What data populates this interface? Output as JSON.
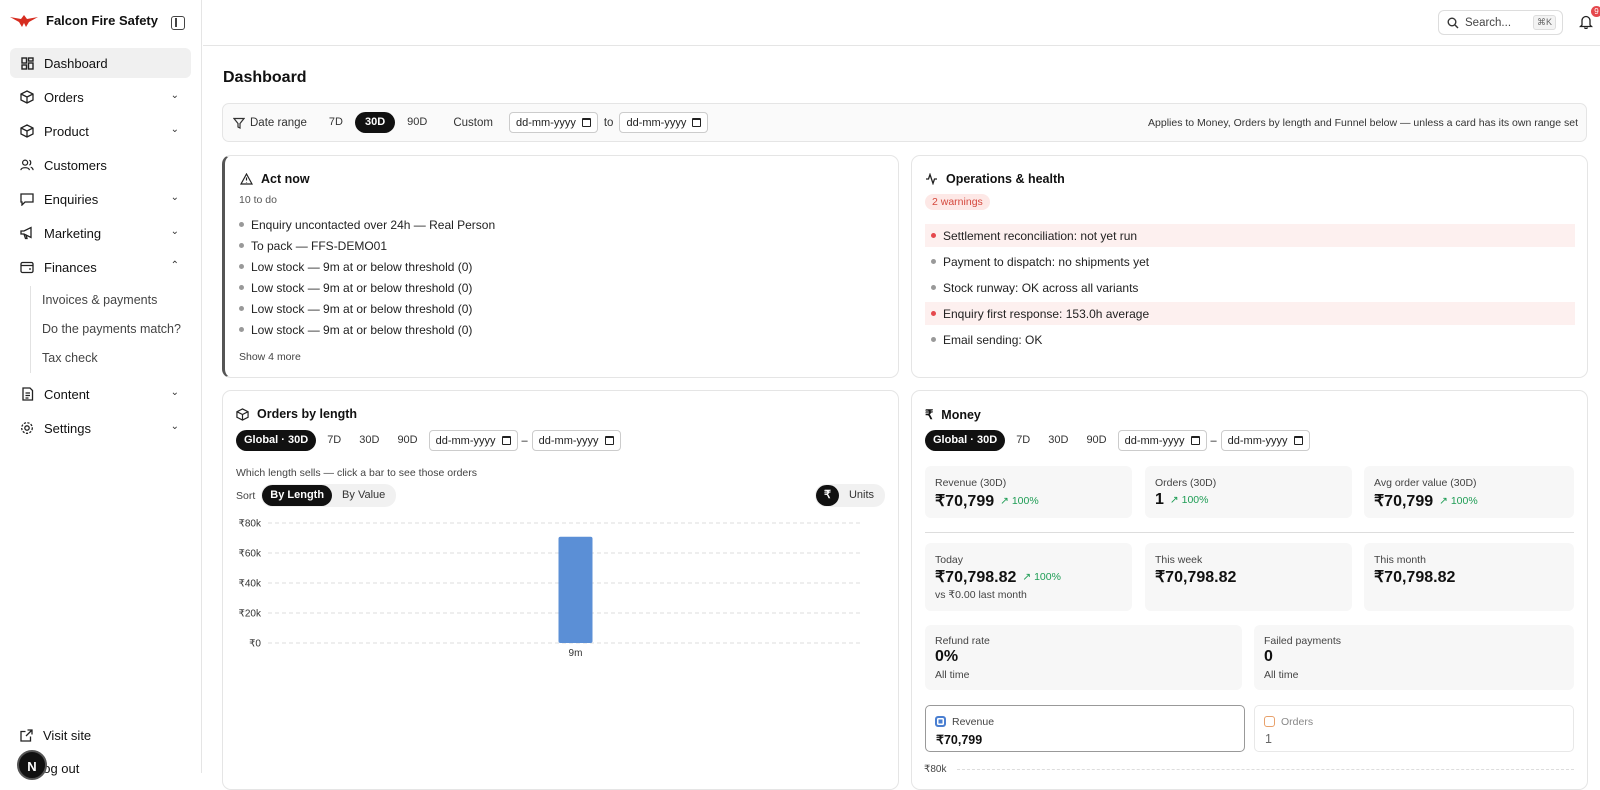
{
  "brand": {
    "name": "Falcon Fire Safety"
  },
  "sidebar": {
    "items": [
      {
        "label": "Dashboard",
        "icon": "grid-icon"
      },
      {
        "label": "Orders",
        "icon": "box-icon"
      },
      {
        "label": "Product",
        "icon": "box-icon"
      },
      {
        "label": "Customers",
        "icon": "users-icon"
      },
      {
        "label": "Enquiries",
        "icon": "chat-icon"
      },
      {
        "label": "Marketing",
        "icon": "megaphone-icon"
      },
      {
        "label": "Finances",
        "icon": "wallet-icon"
      },
      {
        "label": "Content",
        "icon": "document-icon"
      },
      {
        "label": "Settings",
        "icon": "gear-icon"
      }
    ],
    "finance_sub": [
      "Invoices & payments",
      "Do the payments match?",
      "Tax check"
    ],
    "visit_site": "Visit site",
    "logout": "Log out",
    "avatar": "N"
  },
  "topbar": {
    "search_placeholder": "Search...",
    "shortcut": "⌘K",
    "notifications": "9"
  },
  "page": {
    "title": "Dashboard"
  },
  "filters": {
    "label": "Date range",
    "ranges": [
      "7D",
      "30D",
      "90D"
    ],
    "active": "30D",
    "custom": "Custom",
    "date_placeholder": "dd-mm-yyyy",
    "to": "to",
    "note": "Applies to Money, Orders by length and Funnel below — unless a card has its own range set"
  },
  "act_now": {
    "title": "Act now",
    "subtitle": "10 to do",
    "items": [
      "Enquiry uncontacted over 24h — Real Person",
      "To pack — FFS-DEMO01",
      "Low stock — 9m at or below threshold (0)",
      "Low stock — 9m at or below threshold (0)",
      "Low stock — 9m at or below threshold (0)",
      "Low stock — 9m at or below threshold (0)"
    ],
    "more": "Show 4 more"
  },
  "ops": {
    "title": "Operations & health",
    "badge": "2 warnings",
    "items": [
      {
        "text": "Settlement reconciliation: not yet run",
        "warn": true
      },
      {
        "text": "Payment to dispatch: no shipments yet",
        "warn": false
      },
      {
        "text": "Stock runway: OK across all variants",
        "warn": false
      },
      {
        "text": "Enquiry first response: 153.0h average",
        "warn": true
      },
      {
        "text": "Email sending: OK",
        "warn": false
      }
    ]
  },
  "orders_by_length": {
    "title": "Orders by length",
    "global": "Global · 30D",
    "ranges": [
      "7D",
      "30D",
      "90D"
    ],
    "date_placeholder": "dd-mm-yyyy",
    "dash": "–",
    "caption": "Which length sells — click a bar to see those orders",
    "sort_label": "Sort",
    "sort_options": [
      "By Length",
      "By Value"
    ],
    "toggle": [
      "₹",
      "Units"
    ]
  },
  "chart_data": {
    "type": "bar",
    "categories": [
      "9m"
    ],
    "values": [
      70799
    ],
    "ylim": [
      0,
      80000
    ],
    "yticks": [
      "₹0",
      "₹20k",
      "₹40k",
      "₹60k",
      "₹80k"
    ],
    "tick_values": [
      0,
      20000,
      40000,
      60000,
      80000
    ],
    "color": "#5b8fd6",
    "grid": true
  },
  "money": {
    "title": "Money",
    "global": "Global · 30D",
    "ranges": [
      "7D",
      "30D",
      "90D"
    ],
    "date_placeholder": "dd-mm-yyyy",
    "dash": "–",
    "kpis": [
      {
        "label": "Revenue (30D)",
        "value": "₹70,799",
        "change": "100%"
      },
      {
        "label": "Orders (30D)",
        "value": "1",
        "change": "100%"
      },
      {
        "label": "Avg order value (30D)",
        "value": "₹70,799",
        "change": "100%"
      }
    ],
    "periods": [
      {
        "label": "Today",
        "value": "₹70,798.82",
        "change": "100%",
        "sub": "vs ₹0.00 last month"
      },
      {
        "label": "This week",
        "value": "₹70,798.82"
      },
      {
        "label": "This month",
        "value": "₹70,798.82"
      }
    ],
    "rates": [
      {
        "label": "Refund rate",
        "value": "0%",
        "sub": "All time"
      },
      {
        "label": "Failed payments",
        "value": "0",
        "sub": "All time"
      }
    ],
    "legend": [
      {
        "label": "Revenue",
        "value": "₹70,799",
        "color": "#4a7fd1"
      },
      {
        "label": "Orders",
        "value": "1",
        "color": "#e8a16b"
      }
    ],
    "axis_top": "₹80k"
  }
}
